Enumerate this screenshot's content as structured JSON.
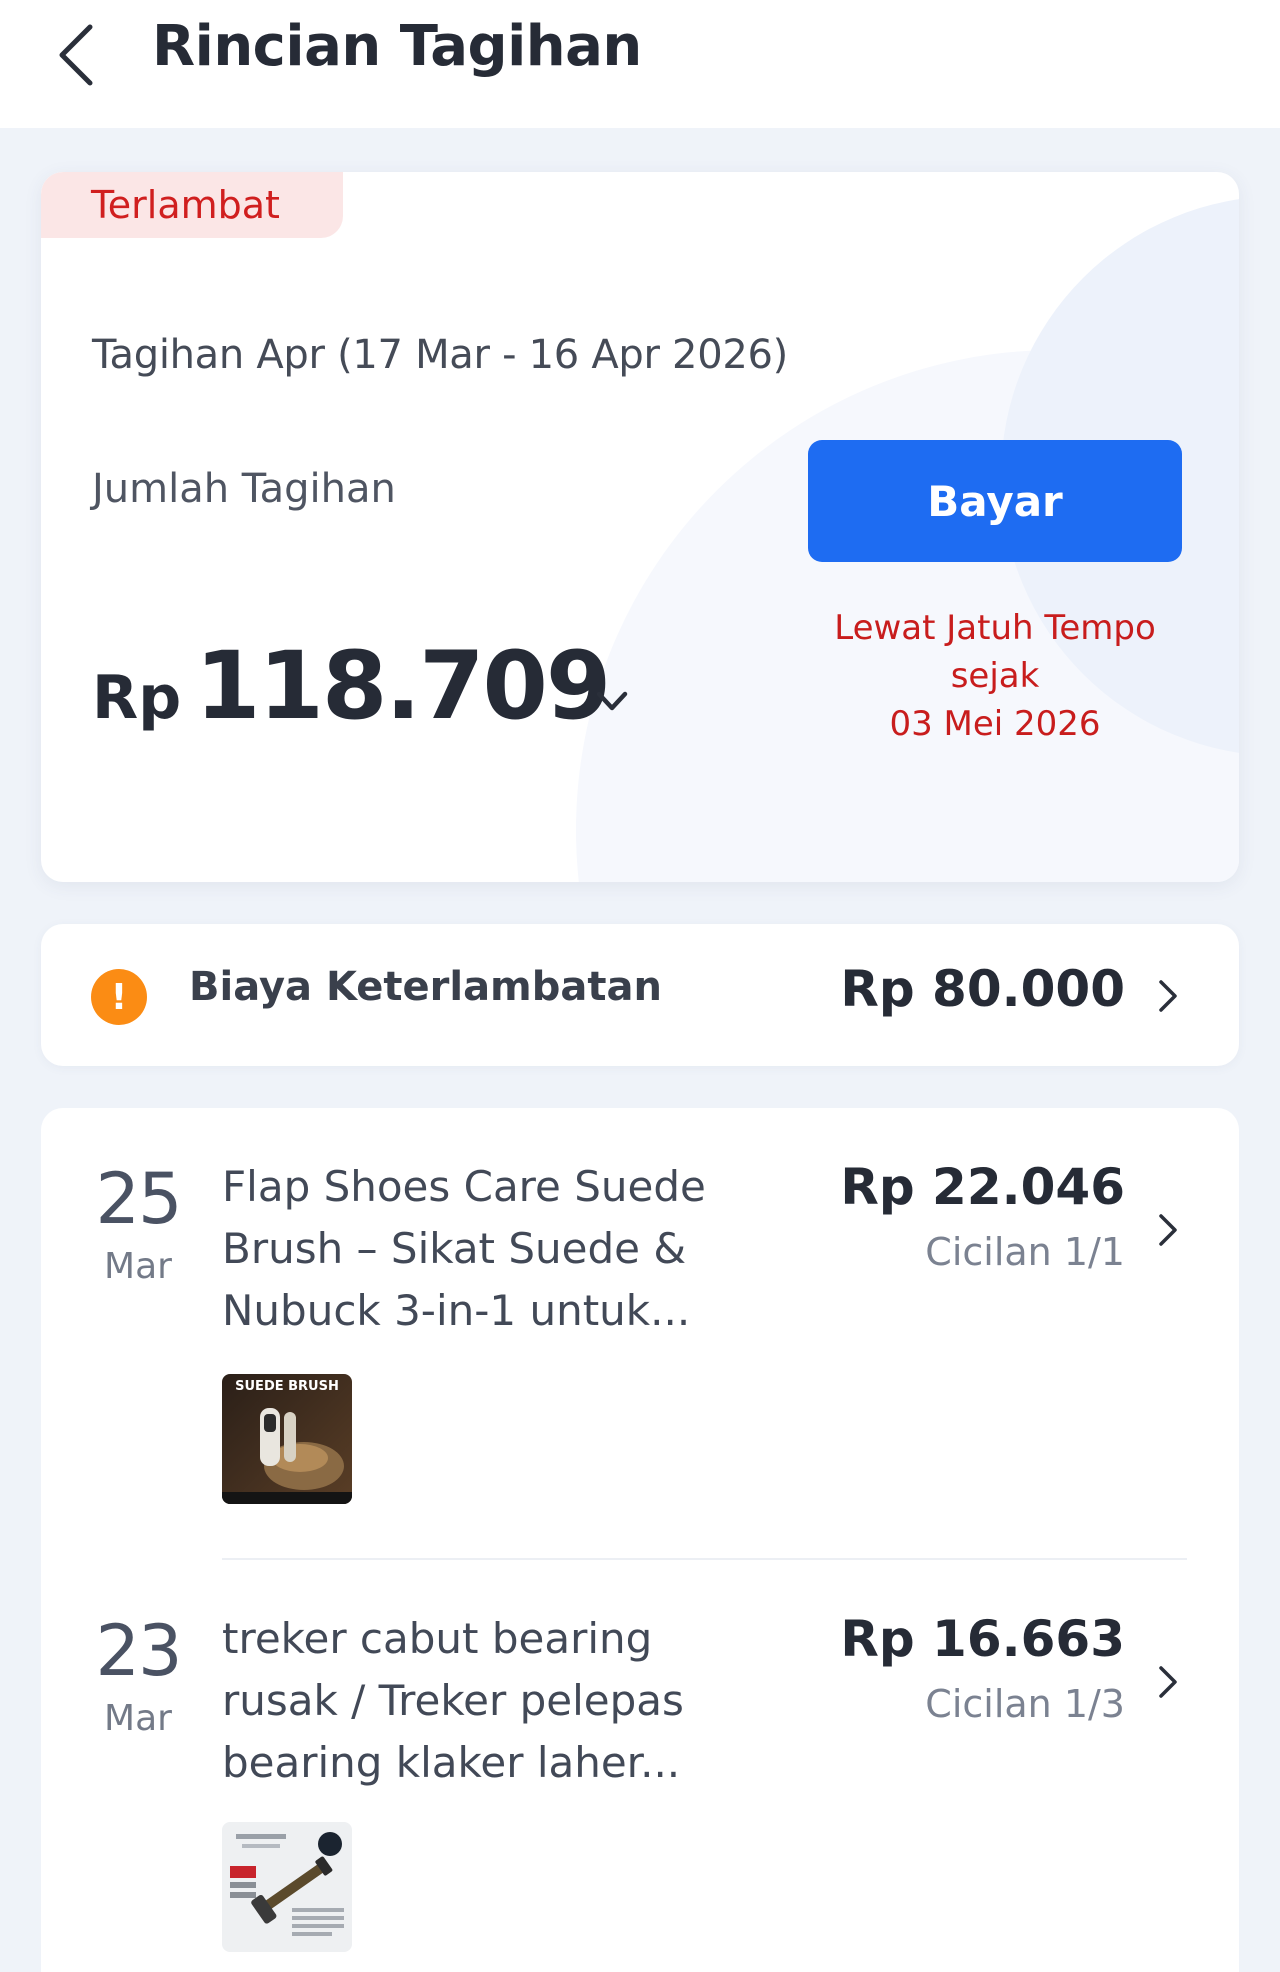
{
  "header": {
    "title": "Rincian Tagihan"
  },
  "summary": {
    "status_badge": "Terlambat",
    "period": "Tagihan Apr (17 Mar - 16 Apr 2026)",
    "amount_label": "Jumlah Tagihan",
    "currency": "Rp",
    "amount": "118.709",
    "pay_button": "Bayar",
    "overdue_line1": "Lewat Jatuh Tempo",
    "overdue_line2": "sejak",
    "overdue_line3": "03 Mei 2026"
  },
  "late_fee": {
    "label": "Biaya Keterlambatan",
    "amount": "Rp 80.000",
    "icon": "!"
  },
  "transactions": [
    {
      "day": "25",
      "month": "Mar",
      "name": "Flap Shoes Care Suede Brush – Sikat Suede & Nubuck 3-in-1 untuk...",
      "amount": "Rp 22.046",
      "installment": "Cicilan 1/1",
      "thumb_text": "SUEDE BRUSH"
    },
    {
      "day": "23",
      "month": "Mar",
      "name": "treker cabut bearing rusak / Treker pelepas bearing klaker laher...",
      "amount": "Rp 16.663",
      "installment": "Cicilan 1/3"
    }
  ],
  "colors": {
    "primary": "#1e6cf2",
    "danger": "#c81d1d",
    "warning": "#fb8c14",
    "background": "#eff3f9"
  }
}
